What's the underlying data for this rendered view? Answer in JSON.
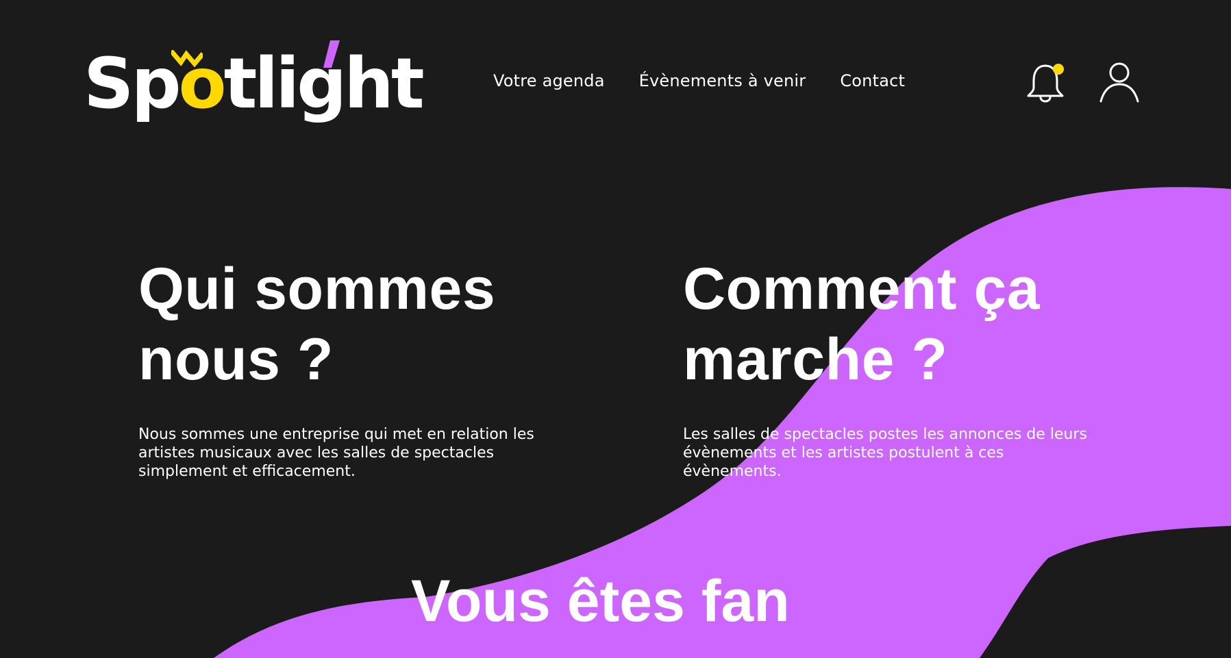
{
  "colors": {
    "background": "#1b1b1b",
    "accent_purple": "#cc66ff",
    "accent_yellow": "#ffd900",
    "text": "#ffffff"
  },
  "header": {
    "logo": {
      "text_before": "Sp",
      "text_o": "o",
      "text_after": "tlight"
    },
    "nav": [
      {
        "label": "Votre agenda"
      },
      {
        "label": "Évènements à venir"
      },
      {
        "label": "Contact"
      }
    ],
    "icons": {
      "notifications": "bell-icon",
      "account": "user-icon"
    }
  },
  "sections": {
    "about": {
      "title_line1": "Qui sommes",
      "title_line2": "nous ?",
      "body": "Nous sommes une entreprise qui met en relation les artistes musicaux avec les salles de spectacles simplement et efficacement."
    },
    "how": {
      "title_line1": "Comment ça",
      "title_line2": "marche ?",
      "body": "Les salles de spectacles postes les annonces de leurs évènements et les artistes postulent à ces évènements."
    },
    "fan": {
      "title_line1": "Vous êtes fan"
    }
  }
}
